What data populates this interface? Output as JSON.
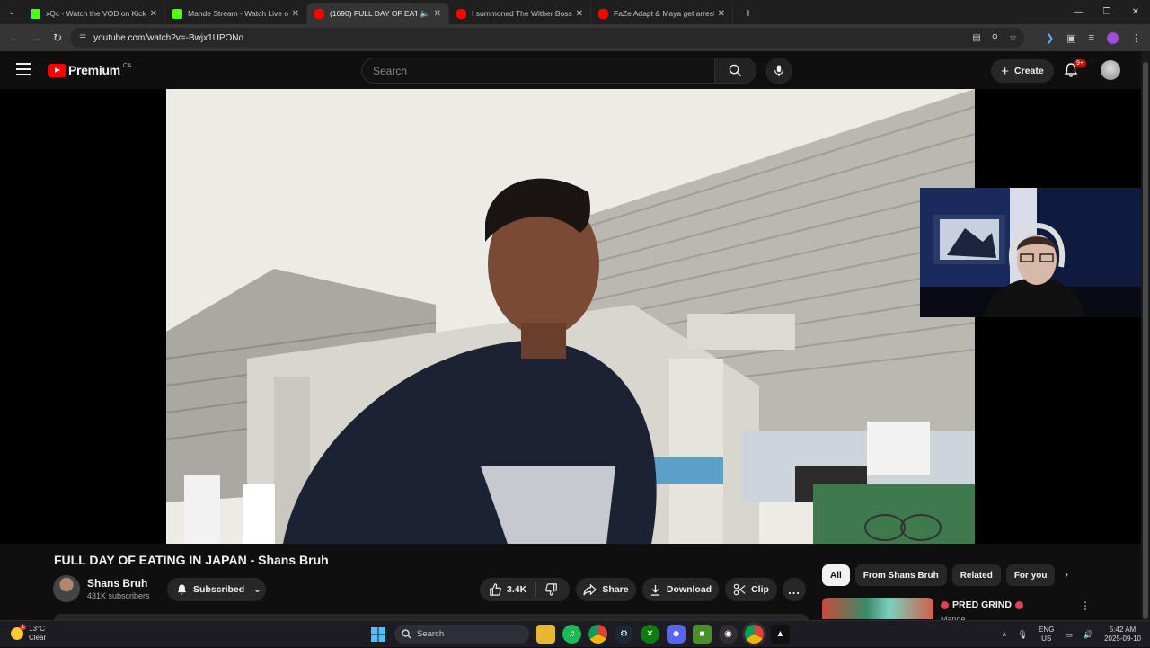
{
  "browser": {
    "tabs": [
      {
        "title": "xQc - Watch the VOD on Kick",
        "favicon_color": "#53fc18",
        "active": false
      },
      {
        "title": "Mande Stream - Watch Live on",
        "favicon_color": "#53fc18",
        "active": false
      },
      {
        "title": "(1690) FULL DAY OF EATING",
        "favicon_color": "#ff0000",
        "active": true
      },
      {
        "title": "I summoned The Wither Boss in",
        "favicon_color": "#ff0000",
        "active": false
      },
      {
        "title": "FaZe Adapt & Maya get arreste",
        "favicon_color": "#ff0000",
        "active": false
      }
    ],
    "url": "youtube.com/watch?v=-Bwjx1UPONo"
  },
  "header": {
    "logo_text": "Premium",
    "country": "CA",
    "search_placeholder": "Search",
    "create_label": "Create",
    "notification_count": "9+"
  },
  "video": {
    "title": "FULL DAY OF EATING IN JAPAN - Shans Bruh",
    "channel_name": "Shans Bruh",
    "subscribers": "431K subscribers",
    "subscribed_label": "Subscribed",
    "likes": "3.4K",
    "share_label": "Share",
    "download_label": "Download",
    "clip_label": "Clip",
    "more_label": "..."
  },
  "sidebar": {
    "chips": [
      "All",
      "From Shans Bruh",
      "Related",
      "For you"
    ],
    "recommendation": {
      "title": "PRED GRIND",
      "channel": "Mande"
    }
  },
  "taskbar": {
    "temperature": "13°C",
    "condition": "Clear",
    "weather_badge": "1",
    "search_placeholder": "Search",
    "lang_top": "ENG",
    "lang_bottom": "US",
    "time": "5:42 AM",
    "date": "2025-09-10"
  }
}
